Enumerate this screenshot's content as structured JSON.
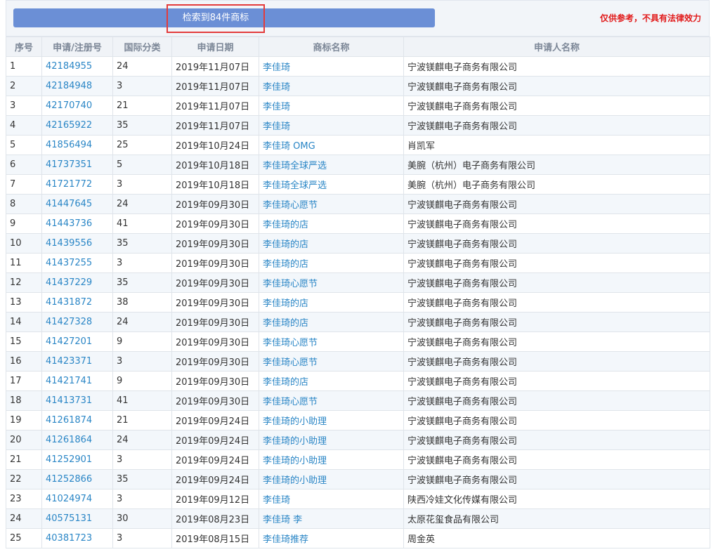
{
  "header": {
    "result_text": "检索到84件商标",
    "disclaimer": "仅供参考，不具有法律效力",
    "result_bar_color": "#6b8fd6",
    "highlight_color": "#e33b3b",
    "disclaimer_color": "#e11919"
  },
  "table": {
    "columns": [
      "序号",
      "申请/注册号",
      "国际分类",
      "申请日期",
      "商标名称",
      "申请人名称"
    ],
    "rows": [
      {
        "no": "1",
        "reg": "42184955",
        "cls": "24",
        "date": "2019年11月07日",
        "mark": "李佳琦",
        "applicant": "宁波镁麒电子商务有限公司"
      },
      {
        "no": "2",
        "reg": "42184948",
        "cls": "3",
        "date": "2019年11月07日",
        "mark": "李佳琦",
        "applicant": "宁波镁麒电子商务有限公司"
      },
      {
        "no": "3",
        "reg": "42170740",
        "cls": "21",
        "date": "2019年11月07日",
        "mark": "李佳琦",
        "applicant": "宁波镁麒电子商务有限公司"
      },
      {
        "no": "4",
        "reg": "42165922",
        "cls": "35",
        "date": "2019年11月07日",
        "mark": "李佳琦",
        "applicant": "宁波镁麒电子商务有限公司"
      },
      {
        "no": "5",
        "reg": "41856494",
        "cls": "25",
        "date": "2019年10月24日",
        "mark": "李佳琦 OMG",
        "applicant": "肖凯军"
      },
      {
        "no": "6",
        "reg": "41737351",
        "cls": "5",
        "date": "2019年10月18日",
        "mark": "李佳琦全球严选",
        "applicant": "美腕（杭州）电子商务有限公司"
      },
      {
        "no": "7",
        "reg": "41721772",
        "cls": "3",
        "date": "2019年10月18日",
        "mark": "李佳琦全球严选",
        "applicant": "美腕（杭州）电子商务有限公司"
      },
      {
        "no": "8",
        "reg": "41447645",
        "cls": "24",
        "date": "2019年09月30日",
        "mark": "李佳琦心愿节",
        "applicant": "宁波镁麒电子商务有限公司"
      },
      {
        "no": "9",
        "reg": "41443736",
        "cls": "41",
        "date": "2019年09月30日",
        "mark": "李佳琦的店",
        "applicant": "宁波镁麒电子商务有限公司"
      },
      {
        "no": "10",
        "reg": "41439556",
        "cls": "35",
        "date": "2019年09月30日",
        "mark": "李佳琦的店",
        "applicant": "宁波镁麒电子商务有限公司"
      },
      {
        "no": "11",
        "reg": "41437255",
        "cls": "3",
        "date": "2019年09月30日",
        "mark": "李佳琦的店",
        "applicant": "宁波镁麒电子商务有限公司"
      },
      {
        "no": "12",
        "reg": "41437229",
        "cls": "35",
        "date": "2019年09月30日",
        "mark": "李佳琦心愿节",
        "applicant": "宁波镁麒电子商务有限公司"
      },
      {
        "no": "13",
        "reg": "41431872",
        "cls": "38",
        "date": "2019年09月30日",
        "mark": "李佳琦的店",
        "applicant": "宁波镁麒电子商务有限公司"
      },
      {
        "no": "14",
        "reg": "41427328",
        "cls": "24",
        "date": "2019年09月30日",
        "mark": "李佳琦的店",
        "applicant": "宁波镁麒电子商务有限公司"
      },
      {
        "no": "15",
        "reg": "41427201",
        "cls": "9",
        "date": "2019年09月30日",
        "mark": "李佳琦心愿节",
        "applicant": "宁波镁麒电子商务有限公司"
      },
      {
        "no": "16",
        "reg": "41423371",
        "cls": "3",
        "date": "2019年09月30日",
        "mark": "李佳琦心愿节",
        "applicant": "宁波镁麒电子商务有限公司"
      },
      {
        "no": "17",
        "reg": "41421741",
        "cls": "9",
        "date": "2019年09月30日",
        "mark": "李佳琦的店",
        "applicant": "宁波镁麒电子商务有限公司"
      },
      {
        "no": "18",
        "reg": "41413731",
        "cls": "41",
        "date": "2019年09月30日",
        "mark": "李佳琦心愿节",
        "applicant": "宁波镁麒电子商务有限公司"
      },
      {
        "no": "19",
        "reg": "41261874",
        "cls": "21",
        "date": "2019年09月24日",
        "mark": "李佳琦的小助理",
        "applicant": "宁波镁麒电子商务有限公司"
      },
      {
        "no": "20",
        "reg": "41261864",
        "cls": "24",
        "date": "2019年09月24日",
        "mark": "李佳琦的小助理",
        "applicant": "宁波镁麒电子商务有限公司"
      },
      {
        "no": "21",
        "reg": "41252901",
        "cls": "3",
        "date": "2019年09月24日",
        "mark": "李佳琦的小助理",
        "applicant": "宁波镁麒电子商务有限公司"
      },
      {
        "no": "22",
        "reg": "41252866",
        "cls": "35",
        "date": "2019年09月24日",
        "mark": "李佳琦的小助理",
        "applicant": "宁波镁麒电子商务有限公司"
      },
      {
        "no": "23",
        "reg": "41024974",
        "cls": "3",
        "date": "2019年09月12日",
        "mark": "李佳琦",
        "applicant": "陕西冷娃文化传媒有限公司"
      },
      {
        "no": "24",
        "reg": "40575131",
        "cls": "30",
        "date": "2019年08月23日",
        "mark": "李佳琦 李",
        "applicant": "太原花玺食品有限公司"
      },
      {
        "no": "25",
        "reg": "40381723",
        "cls": "3",
        "date": "2019年08月15日",
        "mark": "李佳琦推荐",
        "applicant": "周金英"
      }
    ]
  }
}
